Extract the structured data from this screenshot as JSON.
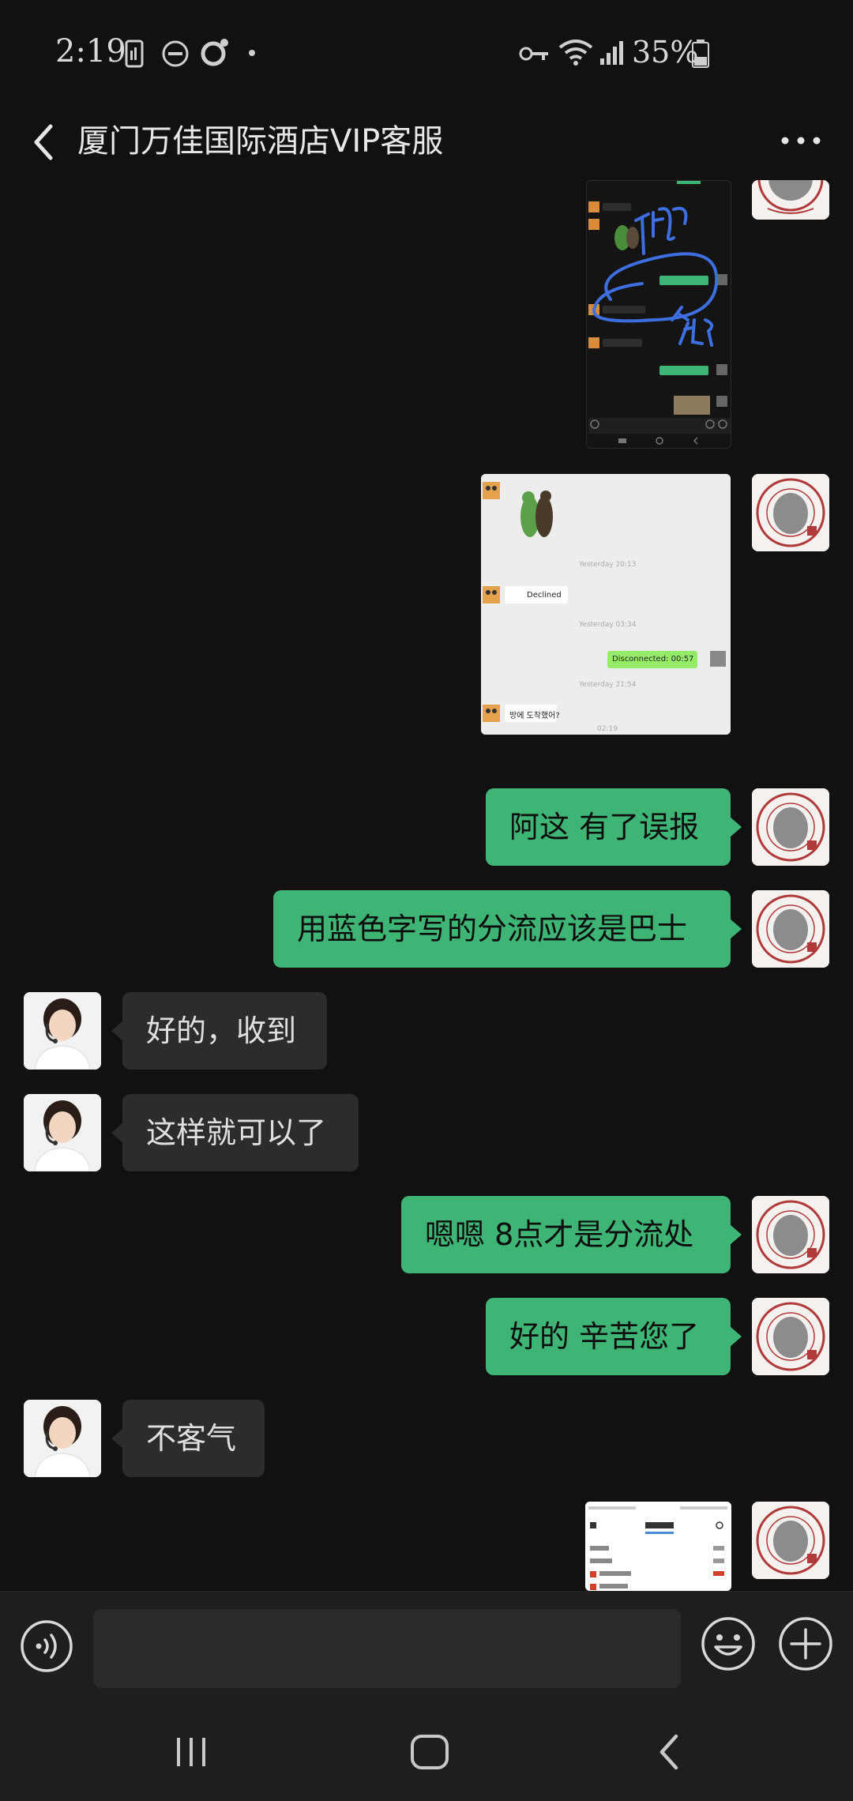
{
  "status_bar": {
    "time": "2:19",
    "battery_percent": "35%"
  },
  "header": {
    "title": "厦门万佳国际酒店VIP客服"
  },
  "messages": {
    "m1": "阿这 有了误报",
    "m2": "用蓝色字写的分流应该是巴士",
    "m3": "好的，收到",
    "m4": "这样就可以了",
    "m5": "嗯嗯 8点才是分流处",
    "m6": "好的 辛苦您了",
    "m7": "不客气"
  },
  "screenshot_preview": {
    "time_1": "Yesterday 20:13",
    "declined": "Declined",
    "time_2": "Yesterday 03:34",
    "disconnected": "Disconnected: 00:57",
    "time_3": "Yesterday 21:54",
    "korean_msg": "방에 도착했어?",
    "time_4": "02:19"
  },
  "colors": {
    "background": "#111111",
    "self_bubble": "#3eb575",
    "agent_bubble": "#2c2c2c",
    "input_bar": "#1e1e1e"
  },
  "icons": {
    "back": "chevron-left-icon",
    "more": "more-horizontal-icon",
    "voice": "voice-icon",
    "emoji": "emoji-icon",
    "plus": "plus-icon"
  }
}
